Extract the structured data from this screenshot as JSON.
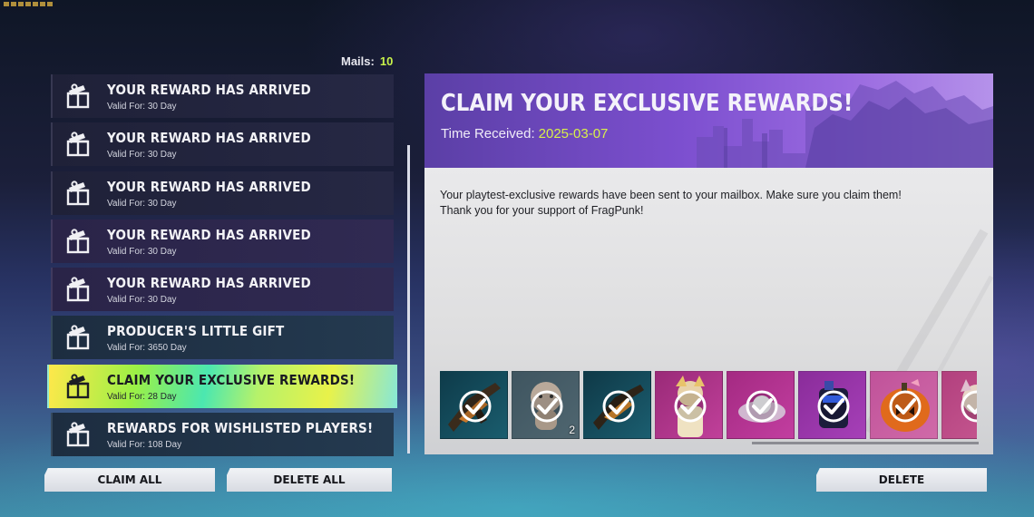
{
  "mails_label": "Mails:",
  "mails_count": "10",
  "mail_list": [
    {
      "title": "YOUR REWARD HAS ARRIVED",
      "valid": "Valid For: 30 Day",
      "icon": "gift-icon"
    },
    {
      "title": "YOUR REWARD HAS ARRIVED",
      "valid": "Valid For: 30 Day",
      "icon": "gift-icon"
    },
    {
      "title": "YOUR REWARD HAS ARRIVED",
      "valid": "Valid For: 30 Day",
      "icon": "gift-icon"
    },
    {
      "title": "YOUR REWARD HAS ARRIVED",
      "valid": "Valid For: 30 Day",
      "icon": "gift-icon"
    },
    {
      "title": "YOUR REWARD HAS ARRIVED",
      "valid": "Valid For: 30 Day",
      "icon": "gift-icon"
    },
    {
      "title": "PRODUCER'S LITTLE GIFT",
      "valid": "Valid For: 3650 Day",
      "icon": "gift-icon"
    },
    {
      "title": "CLAIM YOUR EXCLUSIVE REWARDS!",
      "valid": "Valid For: 28 Day",
      "icon": "gift-icon",
      "selected": true
    },
    {
      "title": "REWARDS FOR WISHLISTED PLAYERS!",
      "valid": "Valid For: 108 Day",
      "icon": "gift-icon"
    }
  ],
  "buttons": {
    "claim_all": "CLAIM ALL",
    "delete_all": "DELETE ALL",
    "delete": "DELETE"
  },
  "detail": {
    "title": "CLAIM YOUR EXCLUSIVE REWARDS!",
    "time_label": "Time Received:",
    "time_value": "2025-03-07",
    "body_line1": "Your playtest-exclusive rewards have been sent to your mailbox. Make sure you claim them!",
    "body_line2": "Thank you for your support of FragPunk!",
    "rewards": [
      {
        "name": "reward-weapon-skin",
        "claimed": true,
        "quantity": ""
      },
      {
        "name": "reward-plush-doll",
        "claimed": true,
        "quantity": "2"
      },
      {
        "name": "reward-weapon-skin",
        "claimed": true,
        "quantity": ""
      },
      {
        "name": "reward-character-outfit",
        "claimed": true,
        "quantity": ""
      },
      {
        "name": "reward-emblem",
        "claimed": true,
        "quantity": ""
      },
      {
        "name": "reward-spray",
        "claimed": true,
        "quantity": ""
      },
      {
        "name": "reward-pumpkin-charm",
        "claimed": true,
        "quantity": ""
      },
      {
        "name": "reward-character-outfit",
        "claimed": true,
        "quantity": ""
      }
    ]
  },
  "colors": {
    "accent_yellow_green": "#c8f24a",
    "date_color": "#d8f04a",
    "header_purple": "#7c4fcf",
    "checkmark": "#ffffff"
  }
}
